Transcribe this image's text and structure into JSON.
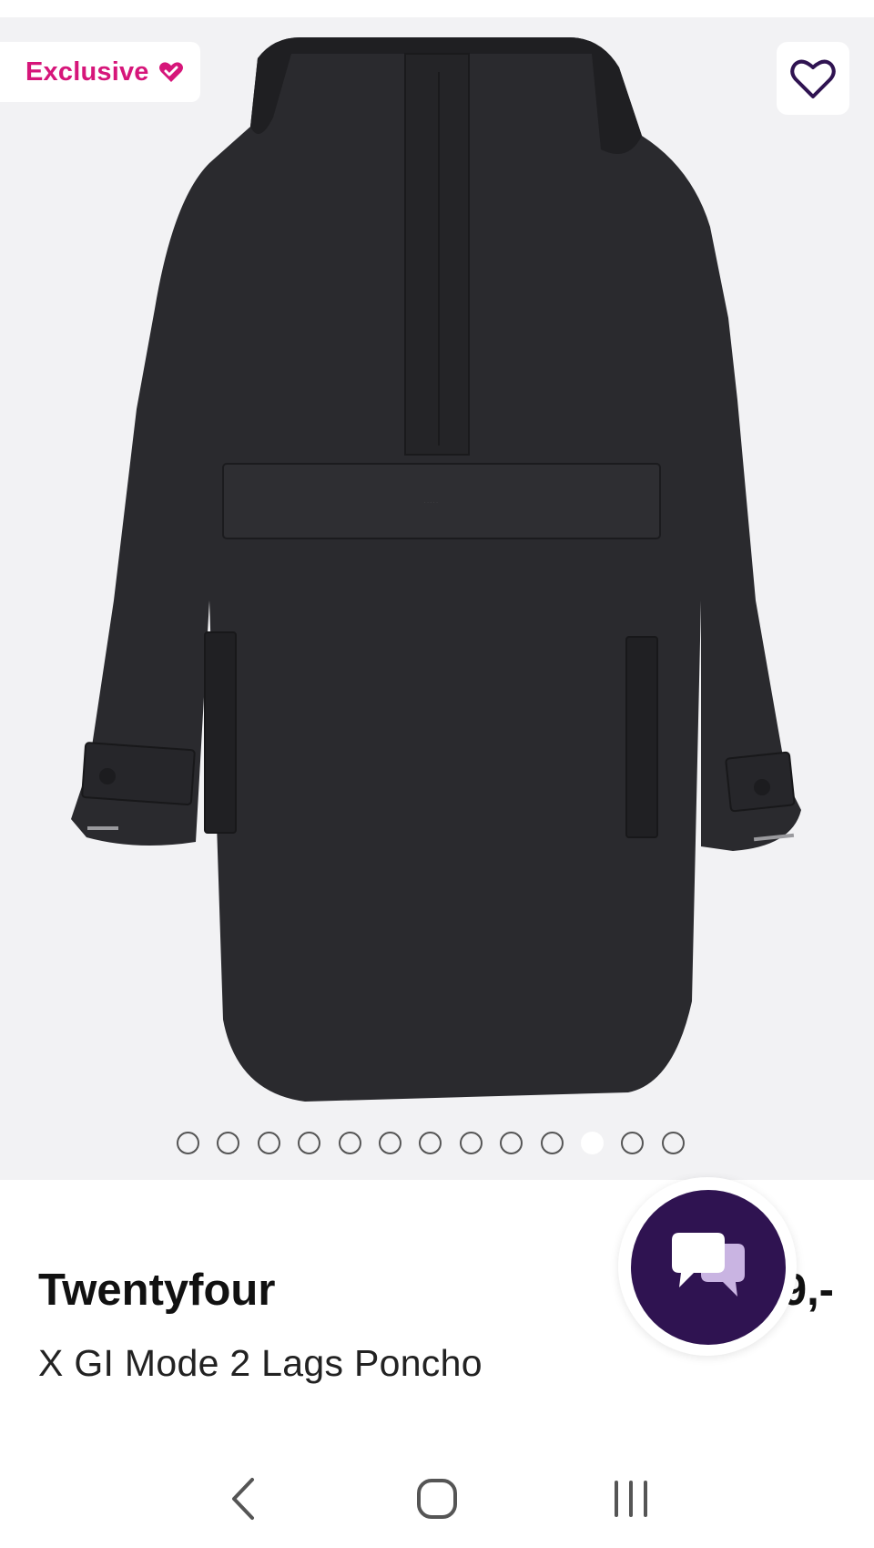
{
  "badge": {
    "label": "Exclusive",
    "icon": "heart-check-icon",
    "color": "#d6167a"
  },
  "wishlist": {
    "icon": "heart-outline-icon"
  },
  "gallery": {
    "image_count": 13,
    "active_index": 10
  },
  "product": {
    "brand": "Twentyfour",
    "name": "X GI Mode 2 Lags Poncho",
    "price": "9,-"
  },
  "chat": {
    "icon": "chat-bubbles-icon",
    "color": "#2f1351"
  },
  "system_nav": {
    "back_icon": "back-chevron-icon",
    "home_icon": "home-icon",
    "recents_icon": "recents-icon"
  }
}
